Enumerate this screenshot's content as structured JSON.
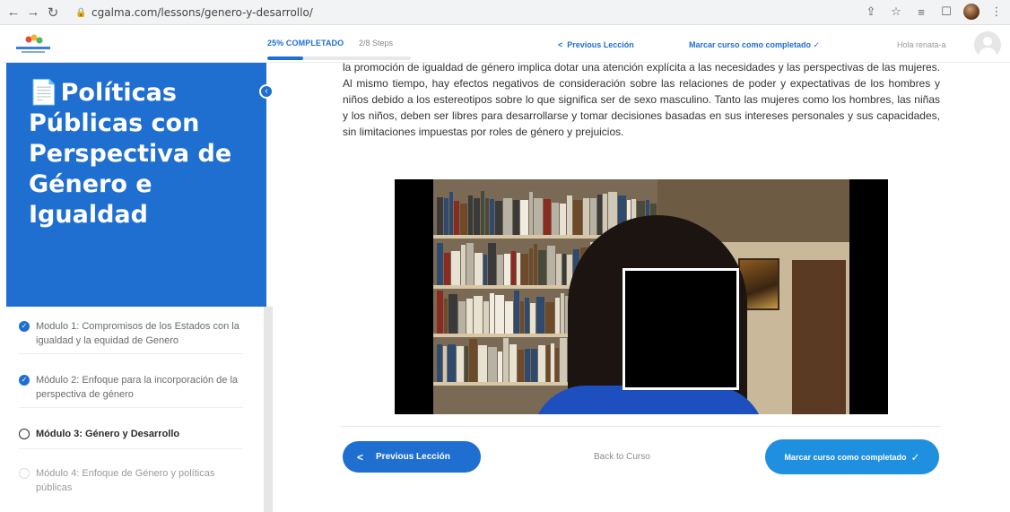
{
  "browser": {
    "url": "cgalma.com/lessons/genero-y-desarrollo/",
    "back_icon": "arrow-left-icon",
    "forward_icon": "arrow-right-icon",
    "reload_icon": "reload-icon"
  },
  "header": {
    "progress_label": "25% COMPLETADO",
    "steps_label": "2/8 Steps",
    "progress_percent": 25,
    "prev_link": "Previous Lección",
    "complete_link": "Marcar curso como completado",
    "greeting": "Hola renata-a"
  },
  "sidebar": {
    "course_title": "Políticas Públicas con Perspectiva de Género e Igualdad",
    "modules": [
      {
        "label": "Modulo 1: Compromisos de los Estados con la igualdad y la equidad de Genero",
        "status": "complete"
      },
      {
        "label": "Módulo 2: Enfoque para la incorporación de la perspectiva de género",
        "status": "complete"
      },
      {
        "label": "Módulo 3: Género y Desarrollo",
        "status": "current"
      },
      {
        "label": "Módulo 4: Enfoque de Género y políticas públicas",
        "status": "incomplete"
      }
    ]
  },
  "main": {
    "paragraph": "la promoción de igualdad de género implica dotar una atención explícita a las necesidades y las perspectivas de las mujeres. Al mismo tiempo, hay efectos negativos de consideración sobre las relaciones de poder y expectativas de los hombres y niños debido a los estereotipos sobre lo que significa ser de sexo masculino. Tanto las mujeres como los hombres, las niñas y los niños, deben ser libres para desarrollarse y tomar decisiones basadas en sus intereses personales y sus capacidades, sin limitaciones impuestas por roles de género y prejuicios.",
    "prev_button": "Previous Lección",
    "back_link": "Back to Curso",
    "complete_button": "Marcar curso como completado"
  },
  "colors": {
    "accent": "#1f6fd1",
    "complete_button": "#1f8fe0"
  }
}
